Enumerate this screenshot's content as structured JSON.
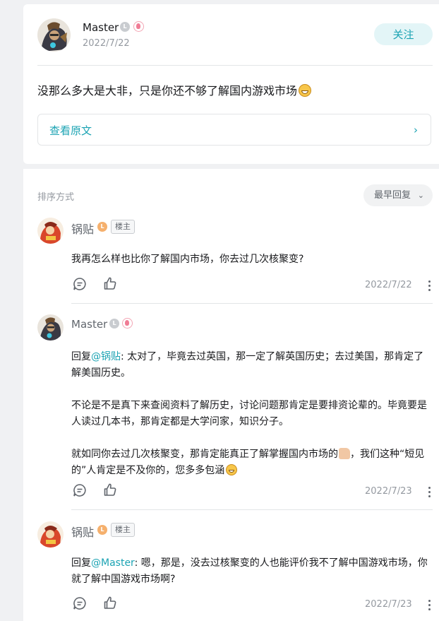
{
  "post": {
    "author": "Master",
    "level_badge": "L",
    "date": "2022/7/22",
    "follow_label": "关注",
    "text": "没那么多大是大非，只是你还不够了解国内游戏市场",
    "view_original_label": "查看原文",
    "chevron": "›"
  },
  "comments_section": {
    "sort_label": "排序方式",
    "sort_value": "最早回复",
    "sort_chevron": "⌄"
  },
  "comments": [
    {
      "author": "锅贴",
      "owner_tag": "楼主",
      "text": "我再怎么样也比你了解国内市场，你去过几次核聚变?",
      "date": "2022/7/22"
    },
    {
      "author": "Master",
      "reply_prefix": "回复",
      "reply_to": "@锅贴",
      "p1_rest": ": 太对了，毕竟去过英国，那一定了解英国历史；去过美国，那肯定了解美国历史。",
      "p2": "不论是不是真下来查阅资料了解历史，讨论问题那肯定是要排资论辈的。毕竟要是人读过几本书，那肯定都是大学问家，知识分子。",
      "p3a": "就如同你去过几次核聚变，那肯定能真正了解掌握国内市场的",
      "p3b": "，我们这种“短见的”人肯定是不及你的，您多多包涵",
      "date": "2022/7/23"
    },
    {
      "author": "锅贴",
      "owner_tag": "楼主",
      "reply_prefix": "回复",
      "reply_to": "@Master",
      "text_rest": ": 嗯，那是，没去过核聚变的人也能评价我不了解中国游戏市场，你就了解中国游戏市场啊?",
      "date": "2022/7/23"
    }
  ],
  "icons": {
    "reply": "comment-bubble-icon",
    "like": "thumbs-up-icon",
    "more": "more-vertical-icon"
  },
  "colors": {
    "accent": "#1ba3b3",
    "accent_bg": "#e3f5f7",
    "text": "#18191c",
    "muted": "#9499a0"
  }
}
